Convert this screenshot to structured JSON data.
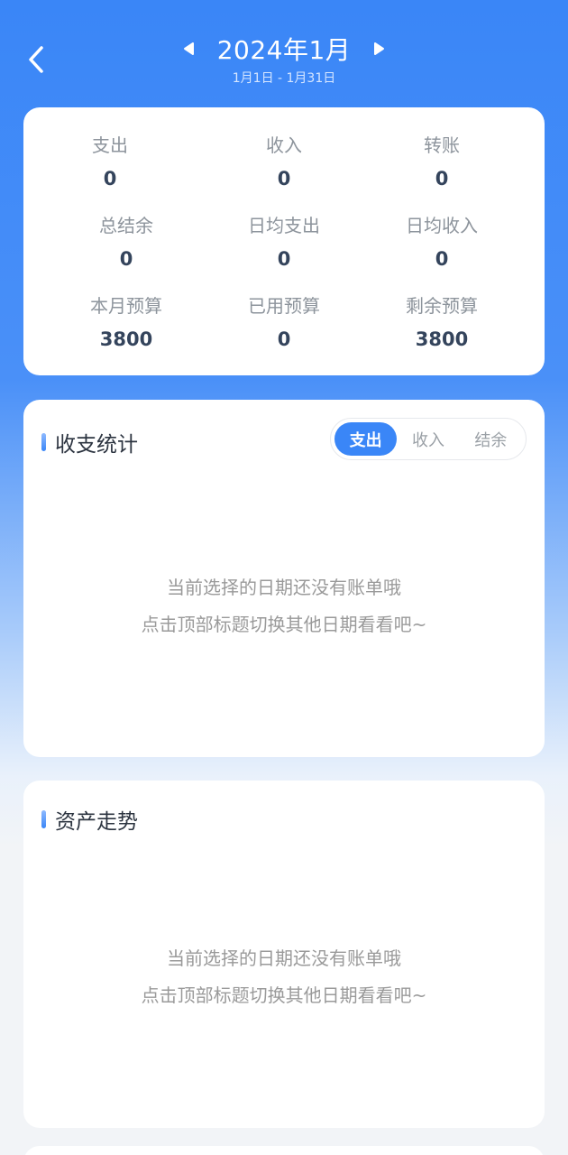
{
  "header": {
    "month_title": "2024年1月",
    "date_range": "1月1日 - 1月31日"
  },
  "stats": [
    {
      "label": "支出",
      "value": "0"
    },
    {
      "label": "收入",
      "value": "0"
    },
    {
      "label": "转账",
      "value": "0"
    },
    {
      "label": "总结余",
      "value": "0"
    },
    {
      "label": "日均支出",
      "value": "0"
    },
    {
      "label": "日均收入",
      "value": "0"
    },
    {
      "label": "本月预算",
      "value": "3800"
    },
    {
      "label": "已用预算",
      "value": "0"
    },
    {
      "label": "剩余预算",
      "value": "3800"
    }
  ],
  "income_expense": {
    "title": "收支统计",
    "tabs": [
      "支出",
      "收入",
      "结余"
    ],
    "active_tab": "支出",
    "empty_line1": "当前选择的日期还没有账单哦",
    "empty_line2": "点击顶部标题切换其他日期看看吧~"
  },
  "asset_trend": {
    "title": "资产走势",
    "empty_line1": "当前选择的日期还没有账单哦",
    "empty_line2": "点击顶部标题切换其他日期看看吧~"
  },
  "colors": {
    "primary": "#3a86f7",
    "value_text": "#34445c",
    "label_text": "#8d949c"
  }
}
